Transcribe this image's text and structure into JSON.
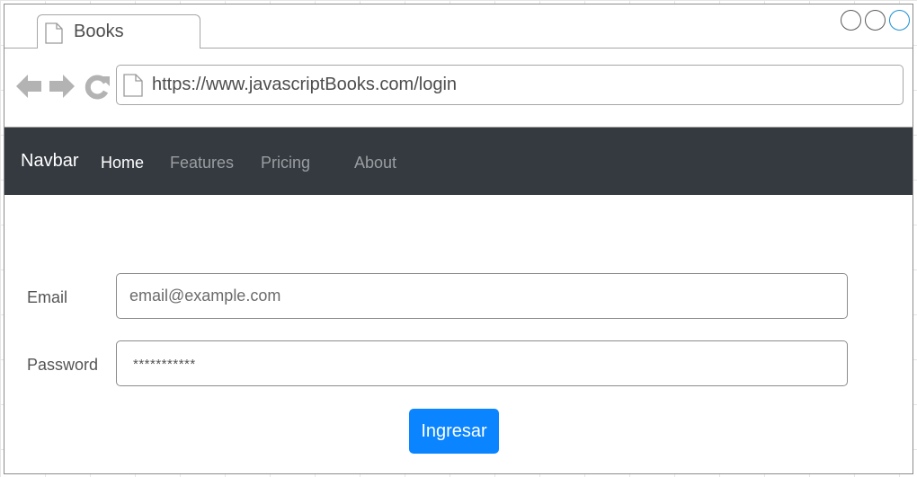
{
  "browser": {
    "tab_title": "Books",
    "url": "https://www.javascriptBooks.com/login"
  },
  "navbar": {
    "brand": "Navbar",
    "links": [
      {
        "label": "Home",
        "active": true
      },
      {
        "label": "Features",
        "active": false
      },
      {
        "label": "Pricing",
        "active": false
      },
      {
        "label": "About",
        "active": false
      }
    ]
  },
  "form": {
    "email_label": "Email",
    "email_placeholder": "email@example.com",
    "password_label": "Password",
    "password_value": "***********",
    "submit_label": "Ingresar"
  },
  "colors": {
    "navbar_bg": "#343a40",
    "primary_button": "#0a84ff"
  }
}
